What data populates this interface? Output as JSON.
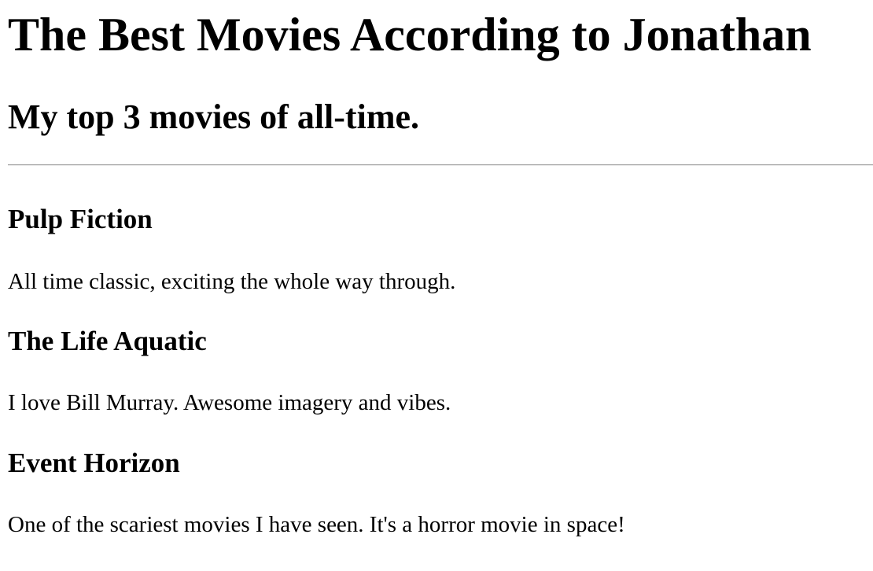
{
  "header": {
    "title": "The Best Movies According to Jonathan",
    "subtitle": "My top 3 movies of all-time."
  },
  "movies": [
    {
      "title": "Pulp Fiction",
      "description": "All time classic, exciting the whole way through."
    },
    {
      "title": "The Life Aquatic",
      "description": "I love Bill Murray. Awesome imagery and vibes."
    },
    {
      "title": "Event Horizon",
      "description": "One of the scariest movies I have seen. It's a horror movie in space!"
    }
  ]
}
